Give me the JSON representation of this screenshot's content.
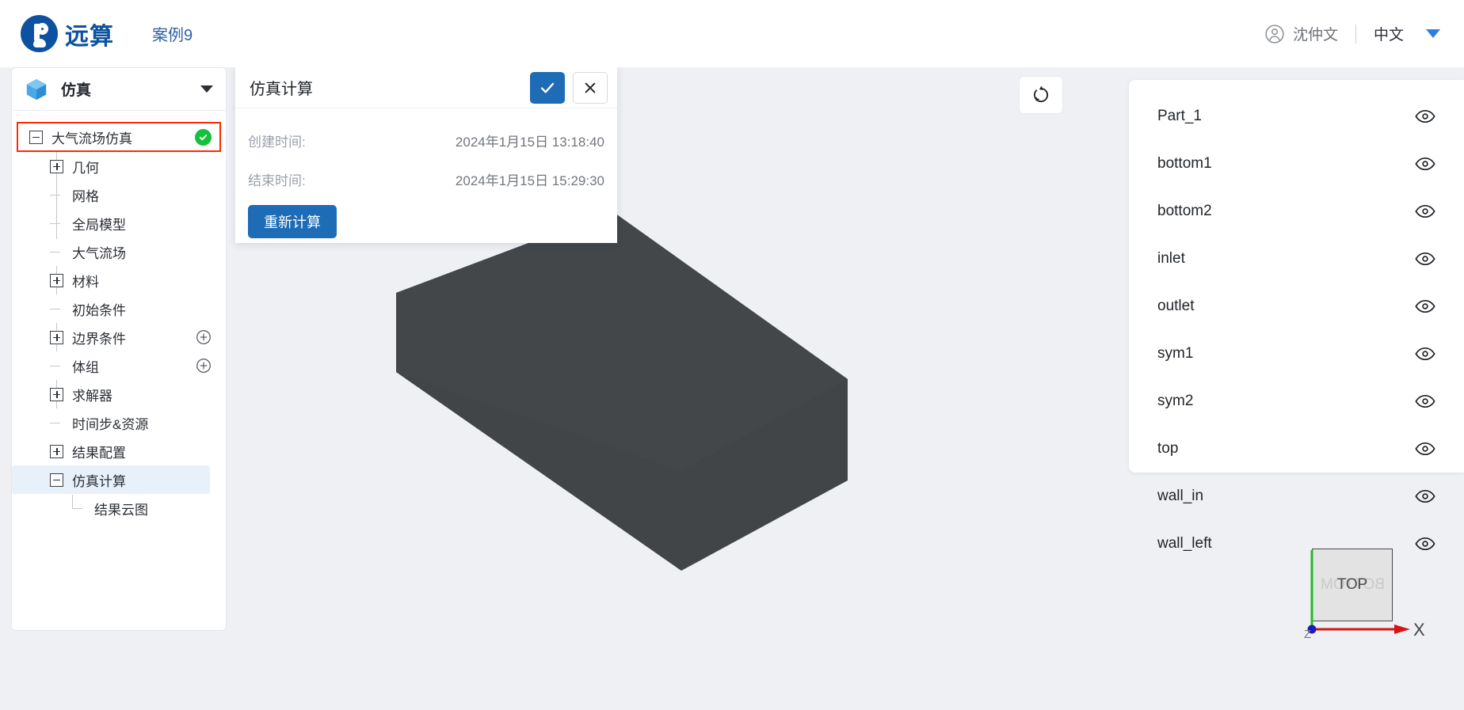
{
  "header": {
    "logo_text_1": "远",
    "logo_text_2": "算",
    "case_name": "案例9",
    "user_name": "沈仲文",
    "language": "中文",
    "user_icon": "user-circle-icon",
    "caret_icon": "chevron-down-icon"
  },
  "tree_panel": {
    "title": "仿真",
    "icon": "cube-icon",
    "collapse_icon": "chevron-down-icon",
    "items": [
      {
        "label": "大气流场仿真",
        "level": 0,
        "expander": "minus",
        "status": "done",
        "highlighted": true
      },
      {
        "label": "几何",
        "level": 1,
        "expander": "plus"
      },
      {
        "label": "网格",
        "level": 1,
        "expander": "leaf"
      },
      {
        "label": "全局模型",
        "level": 1,
        "expander": "leaf"
      },
      {
        "label": "大气流场",
        "level": 1,
        "expander": "leaf"
      },
      {
        "label": "材料",
        "level": 1,
        "expander": "plus"
      },
      {
        "label": "初始条件",
        "level": 1,
        "expander": "leaf"
      },
      {
        "label": "边界条件",
        "level": 1,
        "expander": "plus",
        "add": true
      },
      {
        "label": "体组",
        "level": 1,
        "expander": "leaf",
        "add": true
      },
      {
        "label": "求解器",
        "level": 1,
        "expander": "plus"
      },
      {
        "label": "时间步&资源",
        "level": 1,
        "expander": "leaf"
      },
      {
        "label": "结果配置",
        "level": 1,
        "expander": "plus"
      },
      {
        "label": "仿真计算",
        "level": 1,
        "expander": "minus",
        "selected": true
      },
      {
        "label": "结果云图",
        "level": 2,
        "expander": "corner"
      }
    ]
  },
  "dialog": {
    "title": "仿真计算",
    "confirm_icon": "check-icon",
    "cancel_icon": "close-icon",
    "rows": [
      {
        "label": "创建时间:",
        "value": "2024年1月15日 13:18:40"
      },
      {
        "label": "结束时间:",
        "value": "2024年1月15日 15:29:30"
      }
    ],
    "recalc_label": "重新计算"
  },
  "viewport": {
    "reset_icon": "rotate-reset-icon",
    "model_color": "#414548",
    "model_color_light": "#4a4e51",
    "background": "#eef0f3"
  },
  "parts_panel": {
    "eye_icon": "eye-icon",
    "items": [
      {
        "name": "Part_1"
      },
      {
        "name": "bottom1"
      },
      {
        "name": "bottom2"
      },
      {
        "name": "inlet"
      },
      {
        "name": "outlet"
      },
      {
        "name": "sym1"
      },
      {
        "name": "sym2"
      },
      {
        "name": "top"
      },
      {
        "name": "wall_in"
      },
      {
        "name": "wall_left"
      }
    ]
  },
  "axis_widget": {
    "cube_face_top": "TOP",
    "cube_face_bottom": "BOTTOM",
    "x_label": "X",
    "z_label": "Z",
    "x_color": "#d71414",
    "z_color": "#22bb22",
    "origin_color": "#1a1ac0"
  }
}
